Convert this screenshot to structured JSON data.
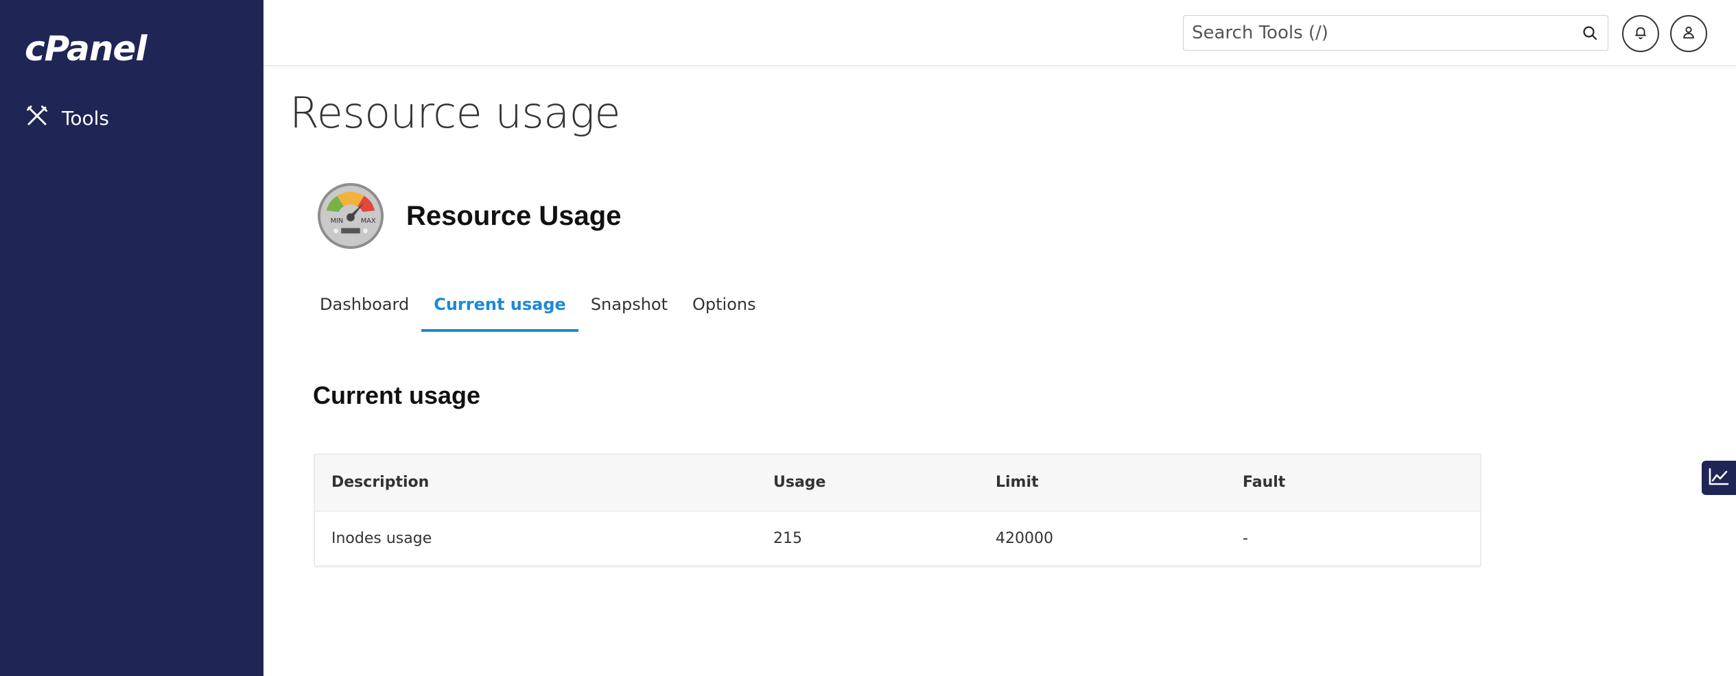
{
  "sidebar": {
    "logo": "cPanel",
    "items": [
      {
        "label": "Tools",
        "icon": "tools-icon"
      }
    ]
  },
  "header": {
    "search_placeholder": "Search Tools (/)",
    "search_value": ""
  },
  "page": {
    "title": "Resource usage",
    "app_title": "Resource Usage",
    "gauge_min": "MIN",
    "gauge_max": "MAX"
  },
  "tabs": [
    {
      "label": "Dashboard",
      "active": false
    },
    {
      "label": "Current usage",
      "active": true
    },
    {
      "label": "Snapshot",
      "active": false
    },
    {
      "label": "Options",
      "active": false
    }
  ],
  "section": {
    "title": "Current usage"
  },
  "table": {
    "headers": [
      "Description",
      "Usage",
      "Limit",
      "Fault"
    ],
    "rows": [
      [
        "Inodes usage",
        "215",
        "420000",
        "-"
      ]
    ]
  },
  "colors": {
    "sidebar_bg": "#1f2555",
    "accent": "#1b8ad3"
  }
}
